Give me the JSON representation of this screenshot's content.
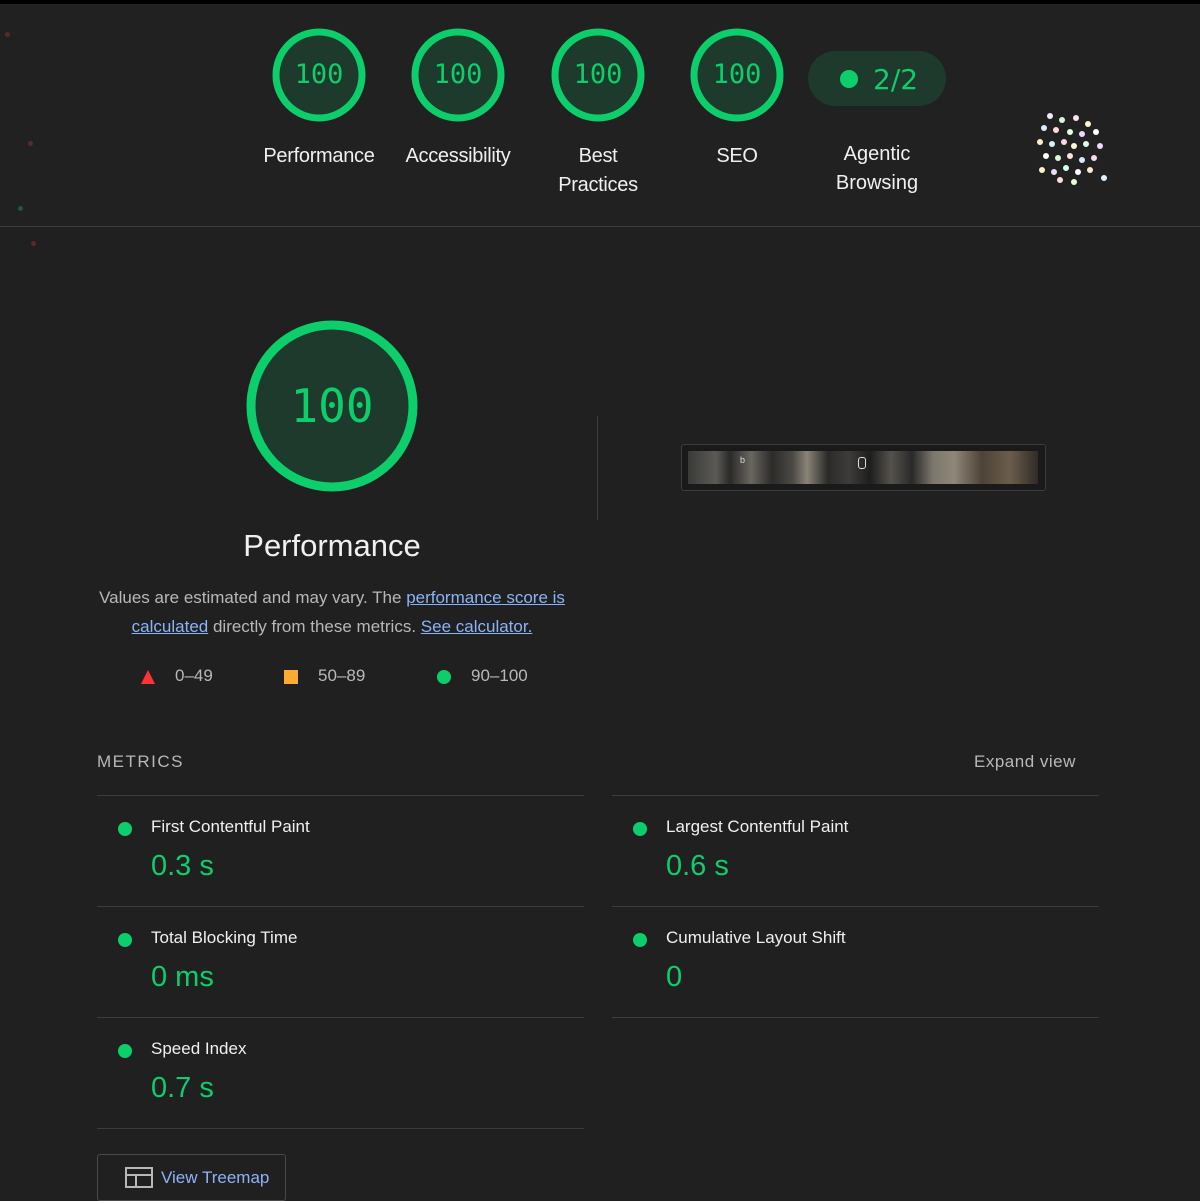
{
  "categories": [
    {
      "score": "100",
      "label": "Performance"
    },
    {
      "score": "100",
      "label": "Accessibility"
    },
    {
      "score": "100",
      "label": "Best Practices"
    },
    {
      "score": "100",
      "label": "SEO"
    }
  ],
  "agentic": {
    "value": "2/2",
    "label": "Agentic Browsing"
  },
  "performance": {
    "score": "100",
    "title": "Performance",
    "desc_prefix": "Values are estimated and may vary. The ",
    "desc_link": "performance score is calculated",
    "desc_mid": " directly from these metrics.",
    "desc_link2": "See calculator."
  },
  "legend": {
    "fail": "0–49",
    "average": "50–89",
    "pass": "90–100"
  },
  "screenshot": {
    "logo_text": "b"
  },
  "metrics": {
    "heading": "METRICS",
    "expand": "Expand view",
    "items": [
      {
        "name": "First Contentful Paint",
        "value": "0.3 s"
      },
      {
        "name": "Largest Contentful Paint",
        "value": "0.6 s"
      },
      {
        "name": "Total Blocking Time",
        "value": "0 ms"
      },
      {
        "name": "Cumulative Layout Shift",
        "value": "0"
      },
      {
        "name": "Speed Index",
        "value": "0.7 s"
      }
    ]
  },
  "treemap": {
    "label": "View Treemap"
  },
  "colors": {
    "pass": "#0cce6b",
    "average": "#ffaa33",
    "fail": "#ff3333",
    "link": "#8ab4f8",
    "background": "#202020"
  }
}
